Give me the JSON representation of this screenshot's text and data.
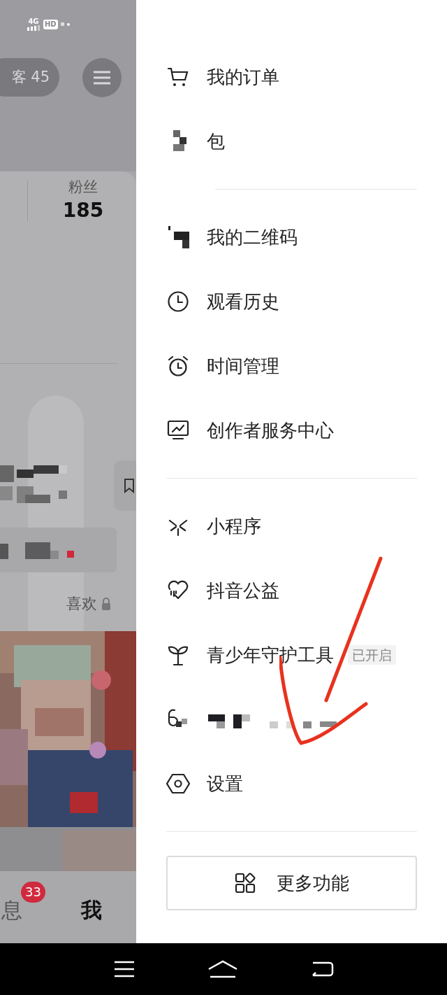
{
  "status_bar": {
    "network": "4G",
    "hd": "HD"
  },
  "profile": {
    "visitors": "客 45",
    "followers_label": "粉丝",
    "followers": "185",
    "tab_label": "喜欢",
    "bottom_nav": [
      {
        "label": "息",
        "badge": "33",
        "selected": false
      },
      {
        "label": "我",
        "selected": true
      }
    ]
  },
  "drawer": {
    "items": [
      {
        "kind": "item",
        "label": "我的订单"
      },
      {
        "kind": "item",
        "label": "包"
      },
      {
        "kind": "divider"
      },
      {
        "kind": "item",
        "label": "我的二维码"
      },
      {
        "kind": "item",
        "label": "观看历史"
      },
      {
        "kind": "item",
        "label": "时间管理"
      },
      {
        "kind": "item",
        "label": "创作者服务中心"
      },
      {
        "kind": "divider"
      },
      {
        "kind": "item",
        "label": "小程序"
      },
      {
        "kind": "item",
        "label": "抖音公益"
      },
      {
        "kind": "item",
        "label": "青少年守护工具",
        "badge": "已开启"
      },
      {
        "kind": "redacted"
      },
      {
        "kind": "item",
        "label": "设置"
      },
      {
        "kind": "divider"
      }
    ],
    "more_button": "更多功能"
  }
}
